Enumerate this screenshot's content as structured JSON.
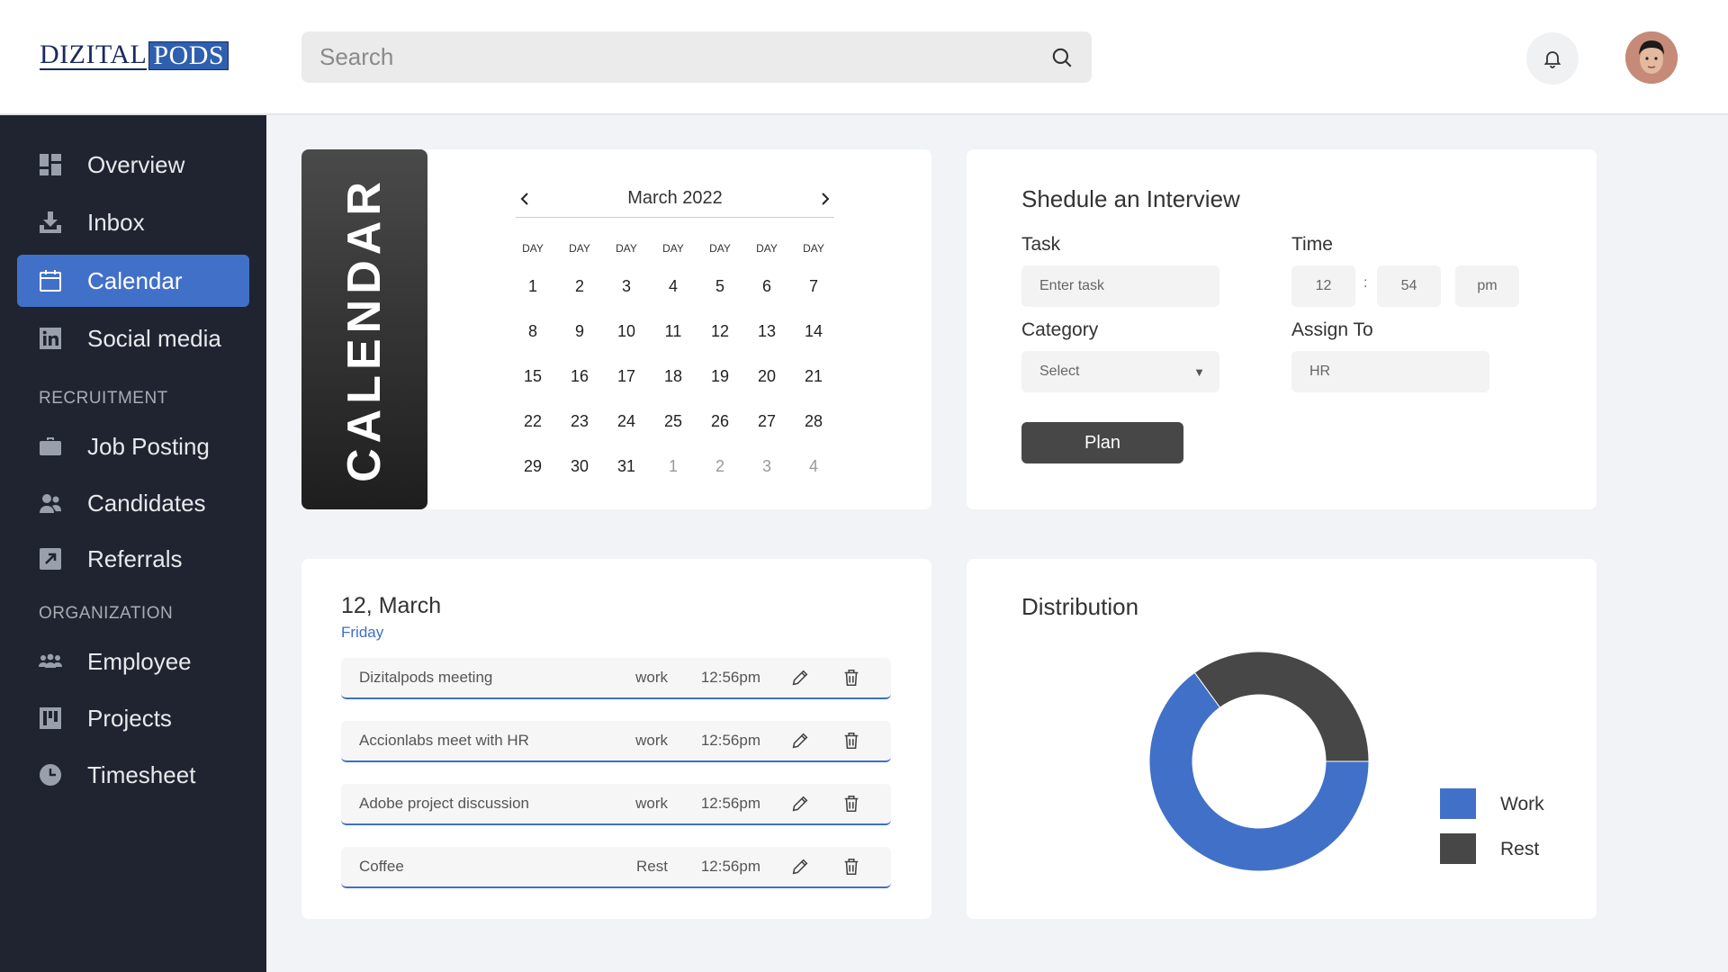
{
  "header": {
    "logo_part1": "DIZITAL",
    "logo_part2": "PODS",
    "search_placeholder": "Search"
  },
  "sidebar": {
    "items": [
      {
        "label": "Overview",
        "icon": "grid-icon"
      },
      {
        "label": "Inbox",
        "icon": "inbox-icon"
      },
      {
        "label": "Calendar",
        "icon": "calendar-icon",
        "active": true
      },
      {
        "label": "Social media",
        "icon": "linkedin-icon"
      }
    ],
    "recruitment_title": "RECRUITMENT",
    "recruitment_items": [
      {
        "label": "Job Posting",
        "icon": "briefcase-icon"
      },
      {
        "label": "Candidates",
        "icon": "users-icon"
      },
      {
        "label": "Referrals",
        "icon": "external-link-icon"
      }
    ],
    "organization_title": "ORGANIZATION",
    "organization_items": [
      {
        "label": "Employee",
        "icon": "group-icon"
      },
      {
        "label": "Projects",
        "icon": "kanban-icon"
      },
      {
        "label": "Timesheet",
        "icon": "clock-icon"
      }
    ],
    "accent_color": "#4170c8"
  },
  "calendar": {
    "banner": "CALENDAR",
    "month": "March 2022",
    "day_headers": [
      "DAY",
      "DAY",
      "DAY",
      "DAY",
      "DAY",
      "DAY",
      "DAY"
    ],
    "weeks": [
      [
        "1",
        "2",
        "3",
        "4",
        "5",
        "6",
        "7"
      ],
      [
        "8",
        "9",
        "10",
        "11",
        "12",
        "13",
        "14"
      ],
      [
        "15",
        "16",
        "17",
        "18",
        "19",
        "20",
        "21"
      ],
      [
        "22",
        "23",
        "24",
        "25",
        "26",
        "27",
        "28"
      ],
      [
        "29",
        "30",
        "31",
        "1",
        "2",
        "3",
        "4"
      ]
    ]
  },
  "schedule": {
    "title": "Shedule an Interview",
    "task_label": "Task",
    "task_placeholder": "Enter task",
    "time_label": "Time",
    "time_hour": "12",
    "time_sep": ":",
    "time_minute": "54",
    "time_period": "pm",
    "category_label": "Category",
    "category_value": "Select",
    "assign_label": "Assign To",
    "assign_value": "HR",
    "plan_button": "Plan"
  },
  "day_view": {
    "date": "12, March",
    "weekday": "Friday",
    "events": [
      {
        "name": "Dizitalpods meeting",
        "category": "work",
        "time": "12:56pm"
      },
      {
        "name": "Accionlabs meet with HR",
        "category": "work",
        "time": "12:56pm"
      },
      {
        "name": "Adobe project discussion",
        "category": "work",
        "time": "12:56pm"
      },
      {
        "name": "Coffee",
        "category": "Rest",
        "time": "12:56pm"
      }
    ]
  },
  "distribution": {
    "title": "Distribution",
    "legend": [
      {
        "label": "Work",
        "color": "#4170c8"
      },
      {
        "label": "Rest",
        "color": "#474747"
      }
    ]
  },
  "chart_data": {
    "type": "pie",
    "categories": [
      "Work",
      "Rest"
    ],
    "values": [
      65,
      35
    ],
    "colors": [
      "#4170c8",
      "#474747"
    ],
    "title": "Distribution"
  }
}
